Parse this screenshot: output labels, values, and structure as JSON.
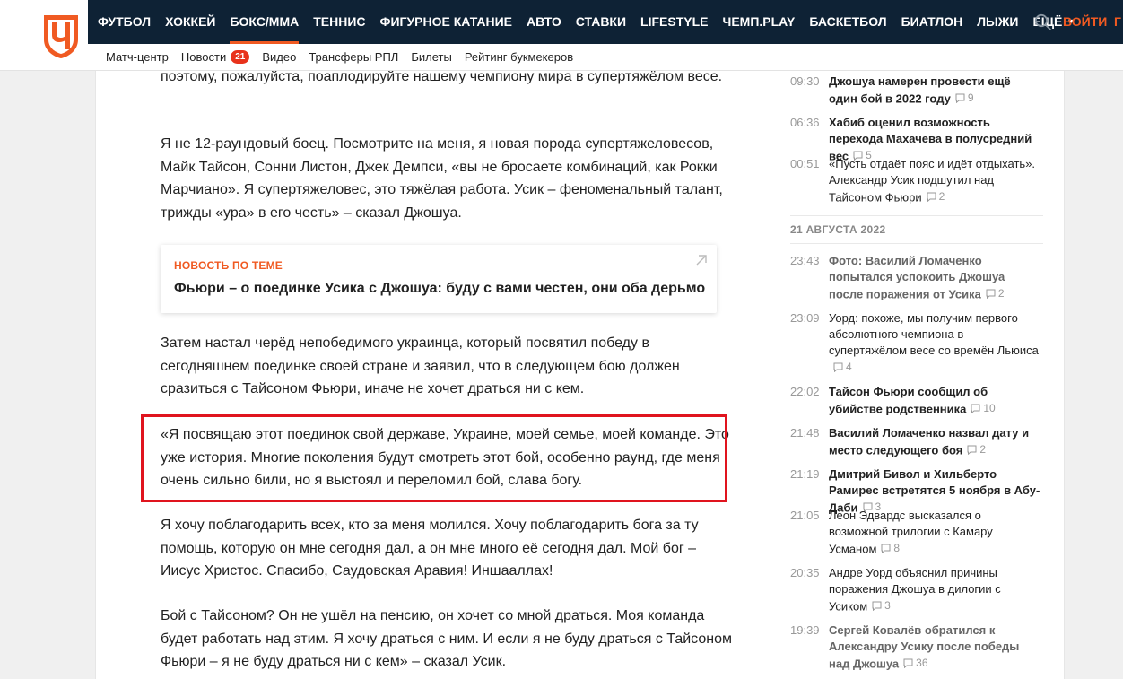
{
  "brand": {
    "logo_letter": "Ч",
    "accent": "#f05a22",
    "nav_bg": "#0e2235"
  },
  "nav": {
    "items": [
      {
        "label": "ФУТБОЛ"
      },
      {
        "label": "ХОККЕЙ"
      },
      {
        "label": "БОКС/ММА",
        "active": true
      },
      {
        "label": "ТЕННИС"
      },
      {
        "label": "ФИГУРНОЕ КАТАНИЕ"
      },
      {
        "label": "АВТО"
      },
      {
        "label": "СТАВКИ"
      },
      {
        "label": "LIFESTYLE"
      },
      {
        "label": "ЧЕМП.PLAY"
      },
      {
        "label": "БАСКЕТБОЛ"
      },
      {
        "label": "БИАТЛОН"
      },
      {
        "label": "ЛЫЖИ"
      }
    ],
    "more_label": "ЕЩЁ",
    "login_label": "ВОЙТИ",
    "edge_label": "Г"
  },
  "subnav": {
    "match_center": "Матч-центр",
    "news": "Новости",
    "news_count": "21",
    "video": "Видео",
    "transfers": "Трансферы РПЛ",
    "tickets": "Билеты",
    "rating": "Рейтинг букмекеров"
  },
  "article": {
    "p0": "поэтому, пожалуйста, поаплодируйте нашему чемпиону мира в супертяжёлом весе.",
    "p1": "Я не 12-раундовый боец. Посмотрите на меня, я новая порода супертяжеловесов, Майк Тайсон, Сонни Листон, Джек Демпси, «вы не бросаете комбинаций, как Рокки Марчиано». Я супертяжеловес, это тяжёлая работа. Усик – феноменальный талант, трижды «ура» в его честь» – сказал Джошуа.",
    "related_label": "НОВОСТЬ ПО ТЕМЕ",
    "related_title": "Фьюри – о поединке Усика с Джошуа: буду с вами честен, они оба дерьмо",
    "p3": "Затем настал черёд непобедимого украинца, который посвятил победу в сегодняшнем поединке своей стране и заявил, что в следующем бою должен сразиться с Тайсоном Фьюри, иначе не хочет драться ни с кем.",
    "p4": "«Я посвящаю этот поединок свой державе, Украине, моей семье, моей команде. Это уже история. Многие поколения будут смотреть этот бой, особенно раунд, где меня очень сильно били, но я выстоял и переломил бой, слава богу.",
    "p5": "Я хочу поблагодарить всех, кто за меня молился. Хочу поблагодарить бога за ту помощь, которую он мне сегодня дал, а он мне много её сегодня дал. Мой бог – Иисус Христос. Спасибо, Саудовская Аравия! Иншааллах!",
    "p6": "Бой с Тайсоном? Он не ушёл на пенсию, он хочет со мной драться. Моя команда будет работать над этим. Я хочу драться с ним. И если я не буду драться с Тайсоном Фьюри – я не буду драться ни с кем» – сказал Усик."
  },
  "sidebar": {
    "date_header": "21 АВГУСТА 2022",
    "news": [
      {
        "time": "09:30",
        "title": "Джошуа намерен провести ещё один бой в 2022 году",
        "comments": "9",
        "style": "bold"
      },
      {
        "time": "06:36",
        "title": "Хабиб оценил возможность перехода Махачева в полусредний вес",
        "comments": "5",
        "style": "bold"
      },
      {
        "time": "00:51",
        "title": "«Пусть отдаёт пояс и идёт отдыхать». Александр Усик подшутил над Тайсоном Фьюри",
        "comments": "2",
        "style": "normal"
      },
      {
        "time": "23:43",
        "title": "Фото: Василий Ломаченко попытался успокоить Джошуа после поражения от Усика",
        "comments": "2",
        "style": "muted"
      },
      {
        "time": "23:09",
        "title": "Уорд: похоже, мы получим первого абсолютного чемпиона в супертяжёлом весе со времён Льюиса",
        "comments": "4",
        "style": "normal"
      },
      {
        "time": "22:02",
        "title": "Тайсон Фьюри сообщил об убийстве родственника",
        "comments": "10",
        "style": "bold"
      },
      {
        "time": "21:48",
        "title": "Василий Ломаченко назвал дату и место следующего боя",
        "comments": "2",
        "style": "bold"
      },
      {
        "time": "21:19",
        "title": "Дмитрий Бивол и Хильберто Рамирес встретятся 5 ноября в Абу-Даби",
        "comments": "3",
        "style": "bold"
      },
      {
        "time": "21:05",
        "title": "Леон Эдвардс высказался о возможной трилогии с Камару Усманом",
        "comments": "8",
        "style": "normal"
      },
      {
        "time": "20:35",
        "title": "Андре Уорд объяснил причины поражения Джошуа в дилогии с Усиком",
        "comments": "3",
        "style": "normal"
      },
      {
        "time": "19:39",
        "title": "Сергей Ковалёв обратился к Александру Усику после победы над Джошуа",
        "comments": "36",
        "style": "muted"
      }
    ]
  }
}
